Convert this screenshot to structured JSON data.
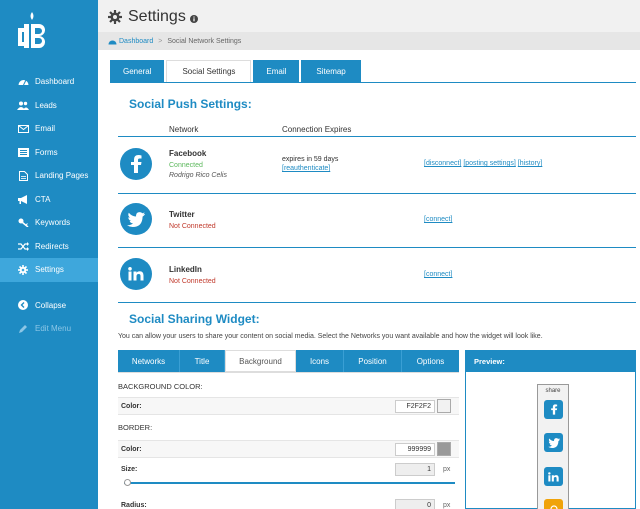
{
  "header": {
    "title": "Settings"
  },
  "breadcrumb": {
    "home": "Dashboard",
    "current": "Social Network Settings"
  },
  "sidebar": {
    "items": [
      {
        "label": "Dashboard",
        "icon": "tachometer-icon"
      },
      {
        "label": "Leads",
        "icon": "users-icon"
      },
      {
        "label": "Email",
        "icon": "envelope-icon"
      },
      {
        "label": "Forms",
        "icon": "list-icon"
      },
      {
        "label": "Landing Pages",
        "icon": "file-icon"
      },
      {
        "label": "CTA",
        "icon": "bullhorn-icon"
      },
      {
        "label": "Keywords",
        "icon": "key-icon"
      },
      {
        "label": "Redirects",
        "icon": "random-icon"
      },
      {
        "label": "Settings",
        "icon": "gear-icon"
      }
    ],
    "collapse": "Collapse",
    "edit_menu": "Edit Menu"
  },
  "tabs": [
    "General",
    "Social Settings",
    "Email",
    "Sitemap"
  ],
  "push": {
    "title": "Social Push Settings:",
    "col_network": "Network",
    "col_expires": "Connection Expires",
    "facebook": {
      "name": "Facebook",
      "status": "Connected",
      "user": "Rodrigo Rico Celis",
      "expires": "expires in 59 days",
      "reauth": "[reauthenticate]",
      "disconnect": "[disconnect]",
      "posting": "[posting settings]",
      "history": "[history]"
    },
    "twitter": {
      "name": "Twitter",
      "status": "Not Connected",
      "connect": "[connect]"
    },
    "linkedin": {
      "name": "LinkedIn",
      "status": "Not Connected",
      "connect": "[connect]"
    }
  },
  "widget": {
    "title": "Social Sharing Widget:",
    "description": "You can allow your users to share your content on social media. Select the Networks you want available and how the widget will look like.",
    "tabs": [
      "Networks",
      "Title",
      "Background",
      "Icons",
      "Position",
      "Options"
    ],
    "bg_label": "BACKGROUND COLOR:",
    "color_label": "Color:",
    "bg_color": "F2F2F2",
    "border_label": "BORDER:",
    "border_color": "999999",
    "size_label": "Size:",
    "size_value": "1",
    "radius_label": "Radius:",
    "radius_value": "0",
    "px": "px"
  },
  "preview": {
    "title": "Preview:",
    "share": "share"
  },
  "colors": {
    "primary": "#1e8bc3",
    "sidebar_active": "#3ea7dc",
    "bg_swatch": "#F2F2F2",
    "border_swatch": "#999999"
  }
}
